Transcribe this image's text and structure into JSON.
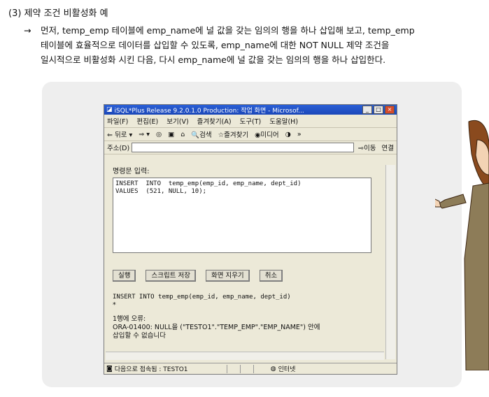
{
  "section": {
    "heading": "(3) 제약 조건 비활성화 예",
    "arrow": "→",
    "lines": [
      "먼저, temp_emp 테이블에 emp_name에 널 값을 갖는 임의의 행을 하나 삽입해 보고, temp_emp",
      "테이블에 효율적으로 데이터를 삽입할 수 있도록, emp_name에 대한 NOT NULL 제약 조건을",
      "일시적으로 비활성화 시킨 다음, 다시 emp_name에 널 값을 갖는 임의의 행을 하나 삽입한다."
    ]
  },
  "window": {
    "title": "iSQL*Plus Release 9.2.0.1.0 Production: 작업 화면 - Microsof...",
    "menu": [
      "파일(F)",
      "편집(E)",
      "보기(V)",
      "즐겨찾기(A)",
      "도구(T)",
      "도움말(H)"
    ],
    "toolbar": [
      "⇐ 뒤로 ▾",
      "⇒ ▾",
      "◎",
      "▣",
      "⌂",
      "🔍검색",
      "☆즐겨찾기",
      "◉미디어",
      "◑",
      "»"
    ],
    "address_label": "주소(D)",
    "go_label": "이동",
    "links_label": "연결",
    "input_label": "명령문 입력:",
    "sql_text": "INSERT  INTO  temp_emp(emp_id, emp_name, dept_id)\nVALUES  (521, NULL, 10);",
    "buttons": [
      "실행",
      "스크립트 저장",
      "화면 지우기",
      "취소"
    ],
    "echo_line1": "INSERT INTO temp_emp(emp_id, emp_name, dept_id)",
    "echo_line2": "*",
    "error_line1": "1행에 오류:",
    "error_line2": "ORA-01400: NULL을 (\"TESTO1\".\"TEMP_EMP\".\"EMP_NAME\") 안에",
    "error_line3": "삽입할 수 없습니다",
    "status_text": "다음으로 접속됨 : TESTO1",
    "zone_text": "인터넷"
  },
  "colors": {
    "title_bar": "#1b47b8",
    "panel_bg": "#eeeeee",
    "window_bg": "#ece9d8"
  }
}
